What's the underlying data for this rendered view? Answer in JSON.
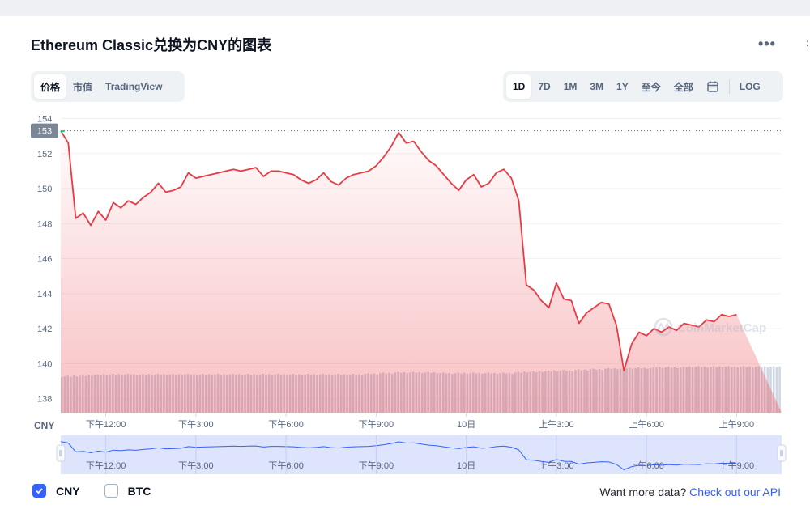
{
  "title": "Ethereum Classic兑换为CNY的图表",
  "more_label": "•••",
  "tabs_left": [
    {
      "label": "价格",
      "active": true
    },
    {
      "label": "市值",
      "active": false
    },
    {
      "label": "TradingView",
      "active": false
    }
  ],
  "tabs_right": [
    {
      "label": "1D",
      "active": true
    },
    {
      "label": "7D",
      "active": false
    },
    {
      "label": "1M",
      "active": false
    },
    {
      "label": "3M",
      "active": false
    },
    {
      "label": "1Y",
      "active": false
    },
    {
      "label": "至今",
      "active": false
    },
    {
      "label": "全部",
      "active": false
    }
  ],
  "log_label": "LOG",
  "calendar_icon": "calendar-icon",
  "currency_label": "CNY",
  "legend": {
    "cny": {
      "label": "CNY",
      "checked": true
    },
    "btc": {
      "label": "BTC",
      "checked": false
    }
  },
  "api_text": "Want more data?",
  "api_link": "Check out our API",
  "watermark": "CoinMarketCap",
  "colors": {
    "line": "#ea3943",
    "line_start": "#16c784",
    "nav_fill": "#dde4fb",
    "nav_line": "#3861fb",
    "volume": "#cfd6e4",
    "price_badge": "#7b8696"
  },
  "chart_data": {
    "type": "area",
    "series": [
      {
        "x_hours": [
          0,
          0.25,
          0.5,
          0.75,
          1,
          1.25,
          1.5,
          1.75,
          2,
          2.25,
          2.5,
          2.75,
          3,
          3.25,
          3.5,
          3.75,
          4,
          4.25,
          4.5,
          4.75,
          5,
          5.25,
          5.5,
          5.75,
          6,
          6.25,
          6.5,
          6.75,
          7,
          7.25,
          7.5,
          7.75,
          8,
          8.25,
          8.5,
          8.75,
          9,
          9.25,
          9.5,
          9.75,
          10,
          10.25,
          10.5,
          10.75,
          11,
          11.25,
          11.5,
          11.75,
          12,
          12.25,
          12.5,
          12.75,
          13,
          13.25,
          13.5,
          13.75,
          14,
          14.25,
          14.5,
          14.75,
          15,
          15.25,
          15.5,
          15.75,
          16,
          16.25,
          16.5,
          16.75,
          17,
          17.25,
          17.5,
          17.75,
          18,
          18.25,
          18.5,
          18.75,
          19,
          19.25,
          19.5,
          19.75,
          20,
          20.25,
          20.5,
          20.75,
          21,
          21.25,
          21.5,
          21.75,
          22,
          22.25,
          22.5,
          22.75,
          23,
          23.25,
          23.5,
          23.75,
          24
        ],
        "values": [
          153.3,
          152.6,
          148.3,
          148.6,
          147.9,
          148.7,
          148.2,
          149.2,
          148.9,
          149.3,
          149.1,
          149.5,
          149.8,
          150.3,
          149.8,
          149.9,
          150.1,
          150.9,
          150.6,
          150.7,
          150.8,
          150.9,
          151.0,
          151.1,
          151.0,
          151.1,
          151.2,
          150.7,
          151.0,
          151.0,
          150.9,
          150.8,
          150.5,
          150.3,
          150.5,
          150.9,
          150.4,
          150.2,
          150.6,
          150.8,
          150.9,
          151.0,
          151.3,
          151.8,
          152.4,
          153.2,
          152.6,
          152.7,
          152.1,
          151.6,
          151.3,
          150.8,
          150.3,
          149.9,
          150.5,
          150.8,
          150.1,
          150.3,
          150.9,
          151.1,
          150.6,
          149.3,
          144.5,
          144.2,
          143.6,
          143.2,
          144.6,
          143.7,
          143.6,
          142.3,
          142.9,
          143.2,
          143.5,
          143.4,
          142.2,
          139.6,
          141.1,
          141.8,
          141.6,
          142.0,
          141.8,
          142.1,
          141.9,
          142.3,
          142.2,
          142.1,
          142.5,
          142.4,
          142.8,
          142.7,
          142.8
        ],
        "volume": [
          0.55,
          0.55,
          0.56,
          0.56,
          0.57,
          0.57,
          0.58,
          0.58,
          0.58,
          0.58,
          0.58,
          0.58,
          0.58,
          0.58,
          0.58,
          0.58,
          0.58,
          0.58,
          0.58,
          0.58,
          0.58,
          0.58,
          0.58,
          0.58,
          0.58,
          0.58,
          0.58,
          0.58,
          0.58,
          0.58,
          0.58,
          0.58,
          0.58,
          0.58,
          0.58,
          0.58,
          0.58,
          0.58,
          0.58,
          0.58,
          0.58,
          0.59,
          0.59,
          0.6,
          0.6,
          0.61,
          0.61,
          0.61,
          0.61,
          0.61,
          0.61,
          0.6,
          0.6,
          0.6,
          0.6,
          0.6,
          0.6,
          0.6,
          0.6,
          0.6,
          0.6,
          0.61,
          0.62,
          0.62,
          0.63,
          0.63,
          0.64,
          0.64,
          0.64,
          0.65,
          0.65,
          0.66,
          0.66,
          0.67,
          0.67,
          0.67,
          0.68,
          0.68,
          0.68,
          0.68,
          0.69,
          0.69,
          0.69,
          0.69,
          0.7,
          0.7,
          0.7,
          0.7,
          0.7,
          0.7,
          0.7
        ]
      }
    ],
    "current_price_label": "153",
    "yticks": [
      154,
      152,
      150,
      148,
      146,
      144,
      142,
      140,
      138
    ],
    "ylim": [
      137.2,
      154.3
    ],
    "xticks": [
      {
        "hour": 1.5,
        "label": "下午12:00"
      },
      {
        "hour": 4.5,
        "label": "下午3:00"
      },
      {
        "hour": 7.5,
        "label": "下午6:00"
      },
      {
        "hour": 10.5,
        "label": "下午9:00"
      },
      {
        "hour": 13.5,
        "label": "10日"
      },
      {
        "hour": 16.5,
        "label": "上午3:00"
      },
      {
        "hour": 19.5,
        "label": "上午6:00"
      },
      {
        "hour": 22.5,
        "label": "上午9:00"
      }
    ],
    "grid": true,
    "scale": "linear"
  }
}
